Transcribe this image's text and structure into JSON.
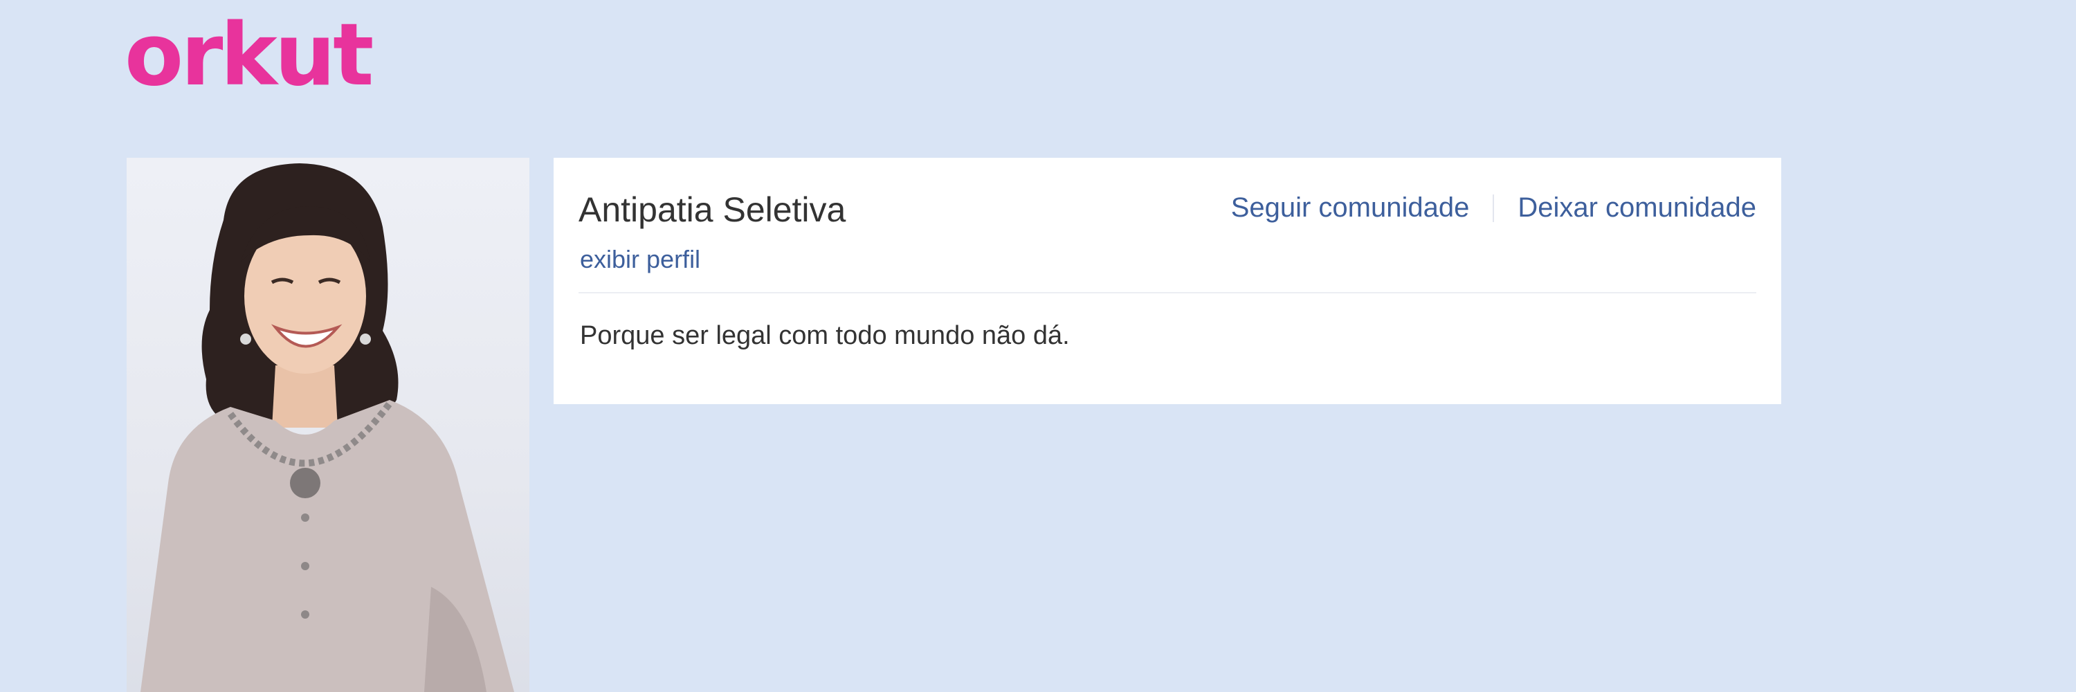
{
  "app": {
    "logo_text": "orkut"
  },
  "community": {
    "name": "Antipatia Seletiva",
    "view_profile_label": "exibir perfil",
    "follow_label": "Seguir comunidade",
    "leave_label": "Deixar comunidade",
    "description": "Porque ser legal com todo mundo não dá."
  },
  "colors": {
    "logo": "#e8339c",
    "link": "#3d5f9c",
    "background": "#d9e4f5",
    "card": "#ffffff",
    "text": "#333333"
  },
  "avatar": {
    "icon": "community-photo-woman-smiling"
  }
}
